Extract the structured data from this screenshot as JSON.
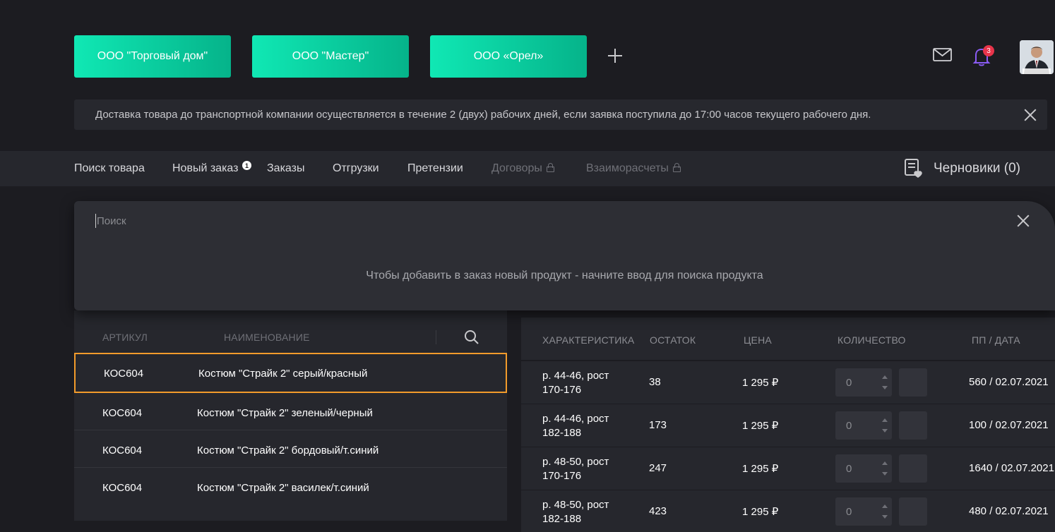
{
  "companies": [
    "ООО \"Торговый дом\"",
    "ООО \"Мастер\"",
    "ООО «Орел»"
  ],
  "header": {
    "notifications_count": "3"
  },
  "notice": {
    "text": "Доставка товара до транспортной компании осуществляется в течение 2 (двух) рабочих дней, если заявка поступила до 17:00 часов текущего рабочего дня."
  },
  "nav": {
    "items": [
      "Поиск товара",
      "Новый заказ",
      "Заказы",
      "Отгрузки",
      "Претензии",
      "Договоры",
      "Взаиморасчеты"
    ],
    "new_order_badge": "1",
    "drafts_label": "Черновики (0)"
  },
  "search": {
    "placeholder": "Поиск",
    "hint": "Чтобы добавить в заказ новый продукт - начните ввод для поиска продукта"
  },
  "products": {
    "headers": {
      "article": "АРТИКУЛ",
      "name": "НАИМЕНОВАНИЕ"
    },
    "rows": [
      {
        "article": "КОС604",
        "name": "Костюм \"Страйк 2\" серый/красный"
      },
      {
        "article": "КОС604",
        "name": "Костюм \"Страйк 2\" зеленый/черный"
      },
      {
        "article": "КОС604",
        "name": "Костюм \"Страйк 2\" бордовый/т.синий"
      },
      {
        "article": "КОС604",
        "name": "Костюм \"Страйк 2\" василек/т.синий"
      }
    ]
  },
  "variants": {
    "headers": {
      "characteristic": "ХАРАКТЕРИСТИКА",
      "stock": "ОСТАТОК",
      "price": "ЦЕНА",
      "quantity": "КОЛИЧЕСТВО",
      "pp_date": "ПП / ДАТА"
    },
    "rows": [
      {
        "char1": "р. 44-46, рост",
        "char2": "170-176",
        "stock": "38",
        "price": "1 295 ₽",
        "qty": "0",
        "pp": "560 / 02.07.2021"
      },
      {
        "char1": "р. 44-46, рост",
        "char2": "182-188",
        "stock": "173",
        "price": "1 295 ₽",
        "qty": "0",
        "pp": "100 / 02.07.2021"
      },
      {
        "char1": "р. 48-50, рост",
        "char2": "170-176",
        "stock": "247",
        "price": "1 295 ₽",
        "qty": "0",
        "pp": "1640 / 02.07.2021"
      },
      {
        "char1": "р. 48-50, рост",
        "char2": "182-188",
        "stock": "423",
        "price": "1 295 ₽",
        "qty": "0",
        "pp": "480 / 02.07.2021"
      }
    ]
  },
  "colors": {
    "accent_start": "#10e8b4",
    "accent_end": "#05b38a",
    "selected_border": "#f29b2b",
    "badge": "#e8344a",
    "bell": "#8b5cf6"
  }
}
